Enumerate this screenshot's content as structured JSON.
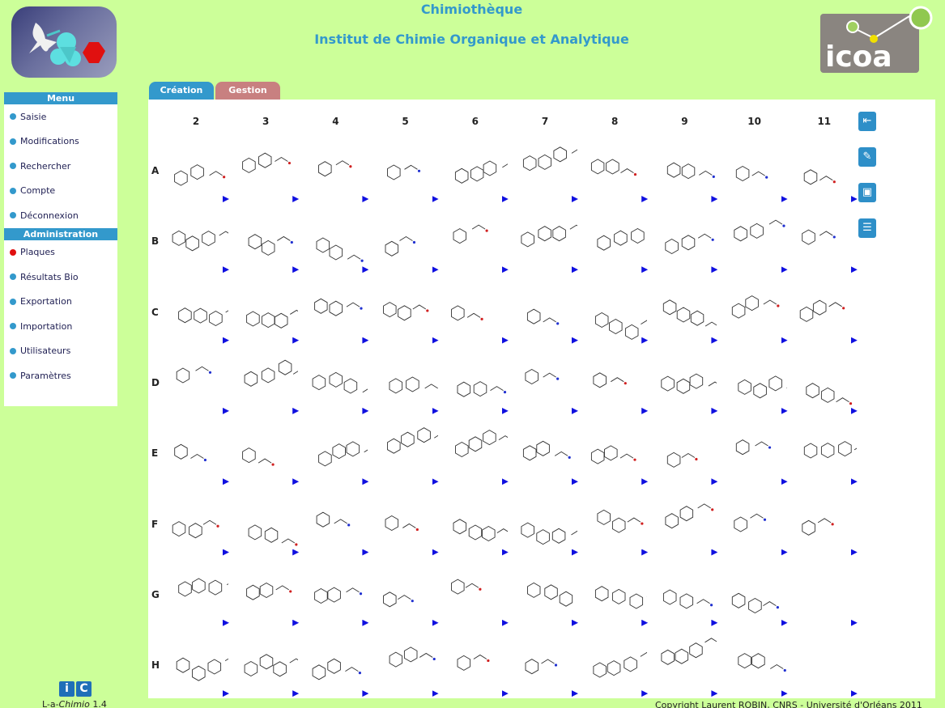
{
  "header": {
    "subtitle": "Chimiothèque",
    "title": "Institut de Chimie Organique et Analytique"
  },
  "logo_right": {
    "text": "icoa"
  },
  "sidebar": {
    "menu_title": "Menu",
    "menu_items": [
      {
        "label": "Saisie",
        "icon": "bullet-icon"
      },
      {
        "label": "Modifications",
        "icon": "bullet-icon"
      },
      {
        "label": "Rechercher",
        "icon": "bullet-icon"
      },
      {
        "label": "Compte",
        "icon": "bullet-icon"
      },
      {
        "label": "Déconnexion",
        "icon": "bullet-icon"
      }
    ],
    "admin_title": "Administration",
    "admin_items": [
      {
        "label": "Plaques",
        "icon": "bullet-icon",
        "active": true
      },
      {
        "label": "Résultats Bio",
        "icon": "bullet-icon"
      },
      {
        "label": "Exportation",
        "icon": "bullet-icon"
      },
      {
        "label": "Importation",
        "icon": "bullet-icon"
      },
      {
        "label": "Utilisateurs",
        "icon": "bullet-icon"
      },
      {
        "label": "Paramètres",
        "icon": "bullet-icon"
      }
    ]
  },
  "tabs": [
    {
      "label": "Création"
    },
    {
      "label": "Gestion"
    }
  ],
  "plate": {
    "columns": [
      "2",
      "3",
      "4",
      "5",
      "6",
      "7",
      "8",
      "9",
      "10",
      "11"
    ],
    "rows": [
      "A",
      "B",
      "C",
      "D",
      "E",
      "F",
      "G",
      "H"
    ],
    "empty_cells": [
      "G-11",
      "H-11"
    ]
  },
  "side_buttons": [
    "back-arrow-icon",
    "edit-icon",
    "save-icon",
    "document-icon"
  ],
  "bottom_logo": {
    "i": "i",
    "c": "C"
  },
  "footer": {
    "version_prefix": "L-a-",
    "version_app": "Chimio",
    "version_number": " 1.4",
    "copyright": "Copyright Laurent ROBIN, CNRS - Université d'Orléans 2011"
  },
  "colors": {
    "background": "#ccff99",
    "accent": "#3399cc",
    "tab_gestion": "#c88080",
    "active_bullet": "#e01010",
    "arrow": "#1010e0"
  }
}
